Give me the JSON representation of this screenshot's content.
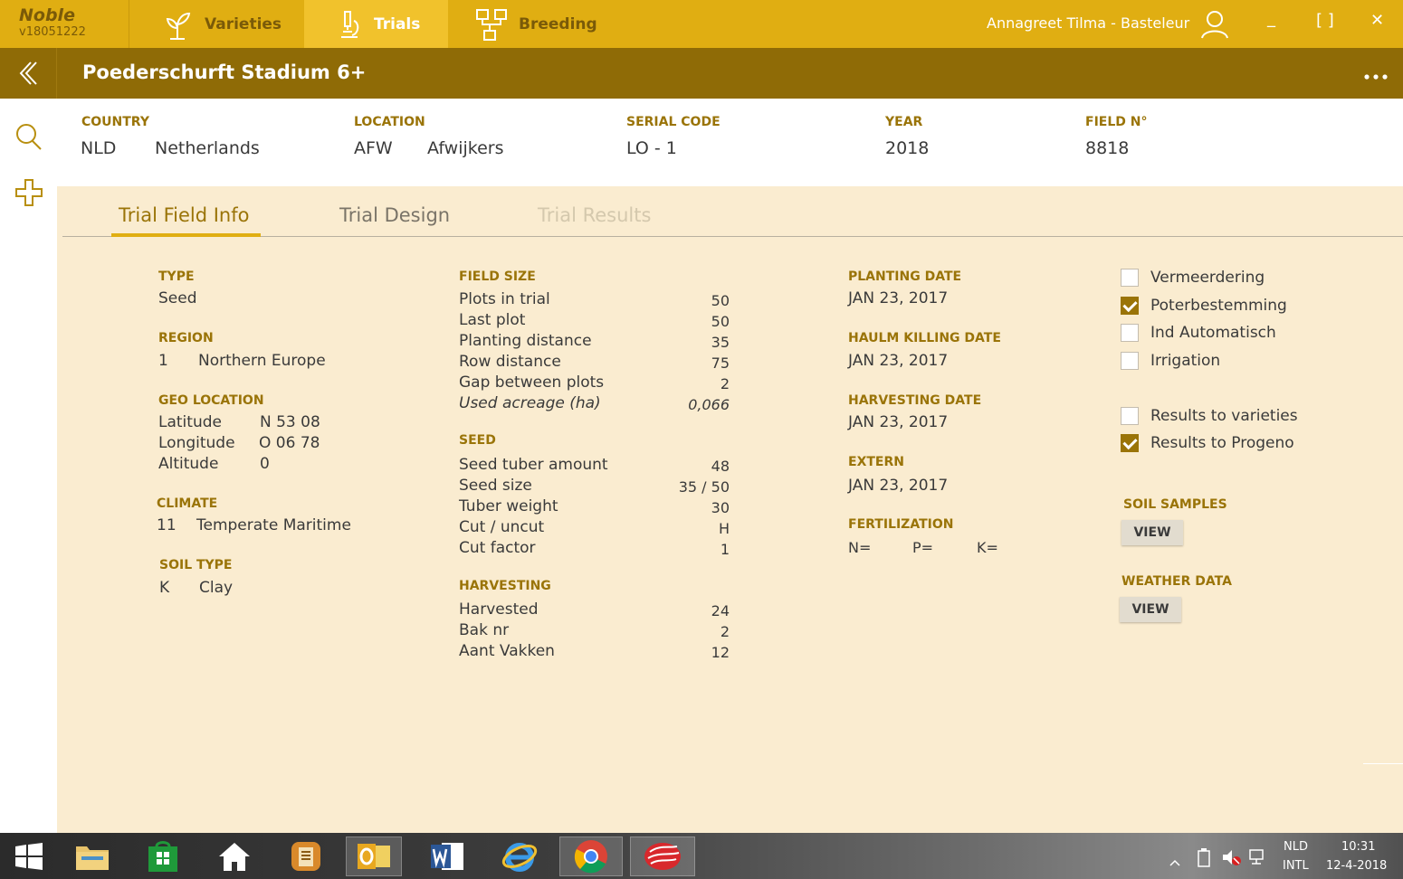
{
  "app": {
    "name": "Noble",
    "version": "v18051222"
  },
  "nav": {
    "tabs": [
      {
        "label": "Varieties",
        "icon": "plant-icon"
      },
      {
        "label": "Trials",
        "icon": "microscope-icon"
      },
      {
        "label": "Breeding",
        "icon": "hierarchy-icon"
      }
    ],
    "active": "Trials"
  },
  "user": {
    "name": "Annagreet Tilma - Basteleur"
  },
  "window": {
    "minimize": "_",
    "maximize": "[ ]",
    "close": "✕"
  },
  "page": {
    "title": "Poederschurft Stadium 6+"
  },
  "header": {
    "country": {
      "label": "COUNTRY",
      "code": "NLD",
      "name": "Netherlands"
    },
    "location": {
      "label": "LOCATION",
      "code": "AFW",
      "name": "Afwijkers"
    },
    "serial": {
      "label": "SERIAL CODE",
      "value": "LO - 1"
    },
    "year": {
      "label": "YEAR",
      "value": "2018"
    },
    "field": {
      "label": "FIELD N°",
      "value": "8818"
    }
  },
  "tabs": [
    {
      "label": "Trial Field Info",
      "state": "active"
    },
    {
      "label": "Trial Design",
      "state": "normal"
    },
    {
      "label": "Trial Results",
      "state": "disabled"
    }
  ],
  "type": {
    "label": "TYPE",
    "value": "Seed"
  },
  "region": {
    "label": "REGION",
    "code": "1",
    "name": "Northern Europe"
  },
  "geo": {
    "label": "GEO LOCATION",
    "rows": [
      {
        "key": "Latitude",
        "value": "N 53 08"
      },
      {
        "key": "Longitude",
        "value": "O 06 78"
      },
      {
        "key": "Altitude",
        "value": "0"
      }
    ]
  },
  "climate": {
    "label": "CLIMATE",
    "code": "11",
    "name": "Temperate Maritime"
  },
  "soil": {
    "label": "SOIL TYPE",
    "code": "K",
    "name": "Clay"
  },
  "field_size": {
    "label": "FIELD SIZE",
    "rows": [
      {
        "key": "Plots in trial",
        "value": "50"
      },
      {
        "key": "Last plot",
        "value": "50"
      },
      {
        "key": "Planting distance",
        "value": "35"
      },
      {
        "key": "Row distance",
        "value": "75"
      },
      {
        "key": "Gap between plots",
        "value": "2"
      },
      {
        "key": "Used acreage (ha)",
        "value": "0,066"
      }
    ]
  },
  "seed": {
    "label": "SEED",
    "rows": [
      {
        "key": "Seed tuber amount",
        "value": "48"
      },
      {
        "key": "Seed size",
        "value": "35 / 50"
      },
      {
        "key": "Tuber weight",
        "value": "30"
      },
      {
        "key": "Cut / uncut",
        "value": "H"
      },
      {
        "key": "Cut factor",
        "value": "1"
      }
    ]
  },
  "harvesting": {
    "label": "HARVESTING",
    "rows": [
      {
        "key": "Harvested",
        "value": "24"
      },
      {
        "key": "Bak nr",
        "value": "2"
      },
      {
        "key": "Aant Vakken",
        "value": "12"
      }
    ]
  },
  "dates": {
    "planting": {
      "label": "PLANTING DATE",
      "value": "JAN 23, 2017"
    },
    "haulm": {
      "label": "HAULM KILLING DATE",
      "value": "JAN 23, 2017"
    },
    "harvesting": {
      "label": "HARVESTING DATE",
      "value": "JAN 23, 2017"
    },
    "extern": {
      "label": "EXTERN",
      "value": "JAN 23, 2017"
    }
  },
  "fertilization": {
    "label": "FERTILIZATION",
    "n": "N=",
    "p": "P=",
    "k": "K="
  },
  "checkboxes": [
    {
      "label": "Vermeerdering",
      "checked": false
    },
    {
      "label": "Poterbestemming",
      "checked": true
    },
    {
      "label": "Ind Automatisch",
      "checked": false
    },
    {
      "label": "Irrigation",
      "checked": false
    },
    {
      "label": "Results to varieties",
      "checked": false
    },
    {
      "label": "Results to Progeno",
      "checked": true
    }
  ],
  "soil_samples": {
    "label": "SOIL SAMPLES",
    "button": "VIEW"
  },
  "weather": {
    "label": "WEATHER DATA",
    "button": "VIEW"
  },
  "tray": {
    "lang1": "NLD",
    "lang2": "INTL",
    "time": "10:31",
    "date": "12-4-2018"
  },
  "colors": {
    "accent": "#e0ae12",
    "dark_accent": "#8f6b06",
    "label": "#9a7408",
    "background": "#faecd0"
  }
}
